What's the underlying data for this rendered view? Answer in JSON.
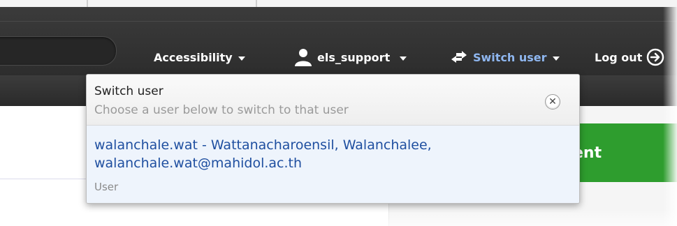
{
  "header": {
    "accessibility_label": "Accessibility",
    "user_label": "els_support",
    "switch_user_label": "Switch user",
    "logout_label": "Log out"
  },
  "background": {
    "green_button_text": "ent"
  },
  "switch_user_dropdown": {
    "title": "Switch user",
    "subtitle": "Choose a user below to switch to that user",
    "users": [
      {
        "name_line1": "walanchale.wat - Wattanacharoensil, Walanchalee,",
        "name_line2": "walanchale.wat@mahidol.ac.th",
        "role": "User"
      }
    ]
  },
  "colors": {
    "topbar": "#333333",
    "active_link": "#8fb7f0",
    "user_link": "#1f4fa0",
    "green_button": "#2e9d2e"
  },
  "icons": [
    "user-icon",
    "switch-arrows-icon",
    "logout-arrow-icon",
    "close-icon",
    "caret-down-icon"
  ]
}
